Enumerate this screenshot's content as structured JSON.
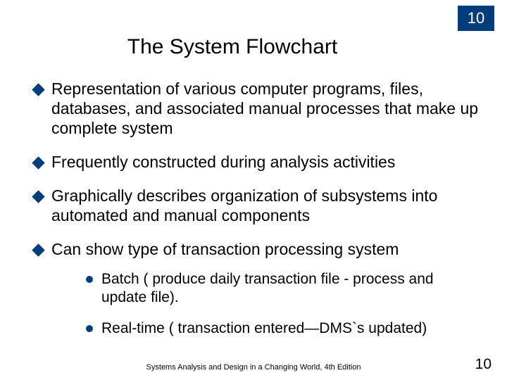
{
  "header": {
    "page_box": "10"
  },
  "title": "The System Flowchart",
  "bullets": [
    "Representation of various computer programs, files, databases, and associated manual processes that make up complete system",
    "Frequently constructed during analysis activities",
    "Graphically describes organization of subsystems into automated and manual components",
    "Can show type of transaction processing system"
  ],
  "sub_bullets": [
    "Batch ( produce daily transaction file - process and update file).",
    "Real-time ( transaction entered—DMS`s updated)"
  ],
  "footer": {
    "citation": "Systems Analysis and Design in a Changing World, 4th Edition",
    "page": "10"
  }
}
